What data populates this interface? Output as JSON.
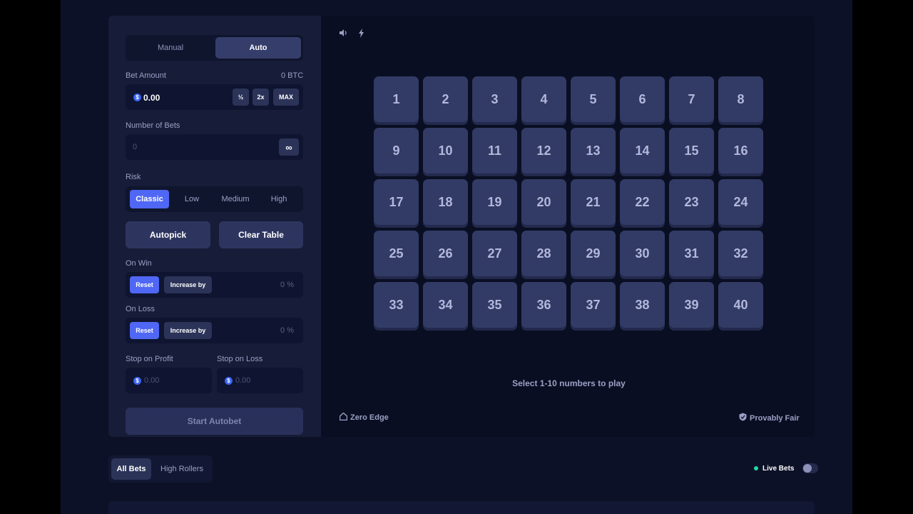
{
  "mode": {
    "manual": "Manual",
    "auto": "Auto",
    "selected": "Auto"
  },
  "bet_amount": {
    "label": "Bet Amount",
    "btc": "0 BTC",
    "value": "0.00",
    "coin": "$",
    "half": "½",
    "double": "2x",
    "max": "MAX"
  },
  "number_of_bets": {
    "label": "Number of Bets",
    "placeholder": "0",
    "infinity": "∞"
  },
  "risk": {
    "label": "Risk",
    "options": [
      "Classic",
      "Low",
      "Medium",
      "High"
    ],
    "selected": "Classic"
  },
  "actions": {
    "autopick": "Autopick",
    "clear_table": "Clear Table"
  },
  "on_win": {
    "label": "On Win",
    "reset": "Reset",
    "increase": "Increase by",
    "value": "0",
    "unit": "%"
  },
  "on_loss": {
    "label": "On Loss",
    "reset": "Reset",
    "increase": "Increase by",
    "value": "0",
    "unit": "%"
  },
  "stop_profit": {
    "label": "Stop on Profit",
    "placeholder": "0.00",
    "coin": "$"
  },
  "stop_loss": {
    "label": "Stop on Loss",
    "placeholder": "0.00",
    "coin": "$"
  },
  "start_button": "Start Autobet",
  "toolbar": {
    "sound_icon": "volume-icon",
    "bolt_icon": "lightning-icon"
  },
  "board": {
    "numbers": [
      1,
      2,
      3,
      4,
      5,
      6,
      7,
      8,
      9,
      10,
      11,
      12,
      13,
      14,
      15,
      16,
      17,
      18,
      19,
      20,
      21,
      22,
      23,
      24,
      25,
      26,
      27,
      28,
      29,
      30,
      31,
      32,
      33,
      34,
      35,
      36,
      37,
      38,
      39,
      40
    ]
  },
  "hint": "Select 1-10 numbers to play",
  "footer": {
    "zero_edge": "Zero Edge",
    "provably_fair": "Provably Fair"
  },
  "bets_tabs": {
    "all": "All Bets",
    "high": "High Rollers",
    "selected": "All Bets"
  },
  "live_bets": {
    "label": "Live Bets",
    "enabled": false
  },
  "colors": {
    "accent": "#4f67f4",
    "tile": "#323b65",
    "panel": "#171c38",
    "background": "#0d1127",
    "live": "#1fd9a0"
  }
}
